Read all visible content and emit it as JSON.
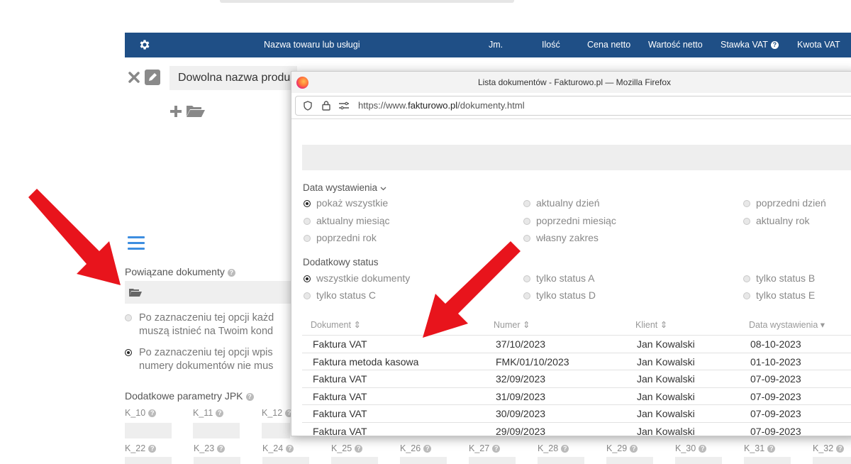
{
  "invoice_header": {
    "columns": [
      "Nazwa towaru lub usługi",
      "Jm.",
      "Ilość",
      "Cena netto",
      "Wartość netto",
      "Stawka VAT",
      "Kwota VAT"
    ]
  },
  "item_row": {
    "name_value": "Dowolna nazwa produ"
  },
  "linked_docs": {
    "label": "Powiązane dokumenty",
    "option1_line1": "Po zaznaczeniu tej opcji każd",
    "option1_line2": "muszą istnieć na Twoim kond",
    "option2_line1": "Po zaznaczeniu tej opcji wpis",
    "option2_line2": "numery dokumentów nie mus"
  },
  "jpk": {
    "label": "Dodatkowe parametry JPK",
    "row1": [
      "K_10",
      "K_11",
      "K_12"
    ],
    "row2": [
      "K_22",
      "K_23",
      "K_24",
      "K_25",
      "K_26",
      "K_27",
      "K_28",
      "K_29",
      "K_30",
      "K_31",
      "K_32"
    ]
  },
  "browser": {
    "title": "Lista dokumentów - Fakturowo.pl — Mozilla Firefox",
    "url_prefix": "https://www.",
    "url_domain": "fakturowo.pl",
    "url_path": "/dokumenty.html"
  },
  "filters": {
    "date_title": "Data wystawienia",
    "date_options": [
      "pokaż wszystkie",
      "aktualny dzień",
      "poprzedni dzień",
      "aktualny miesiąc",
      "poprzedni miesiąc",
      "aktualny rok",
      "poprzedni rok",
      "własny zakres"
    ],
    "status_title": "Dodatkowy status",
    "status_options": [
      "wszystkie dokumenty",
      "tylko status A",
      "tylko status B",
      "tylko status C",
      "tylko status D",
      "tylko status E"
    ]
  },
  "table": {
    "headers": [
      "Dokument",
      "Numer",
      "Klient",
      "Data wystawienia"
    ],
    "rows": [
      [
        "Faktura VAT",
        "37/10/2023",
        "Jan Kowalski",
        "08-10-2023"
      ],
      [
        "Faktura metoda kasowa",
        "FMK/01/10/2023",
        "Jan Kowalski",
        "01-10-2023"
      ],
      [
        "Faktura VAT",
        "32/09/2023",
        "Jan Kowalski",
        "07-09-2023"
      ],
      [
        "Faktura VAT",
        "31/09/2023",
        "Jan Kowalski",
        "07-09-2023"
      ],
      [
        "Faktura VAT",
        "30/09/2023",
        "Jan Kowalski",
        "07-09-2023"
      ],
      [
        "Faktura VAT",
        "29/09/2023",
        "Jan Kowalski",
        "07-09-2023"
      ]
    ]
  },
  "colors": {
    "header_bg": "#1f4f86",
    "arrow": "#e8141c",
    "menu_accent": "#3d8ee0"
  }
}
